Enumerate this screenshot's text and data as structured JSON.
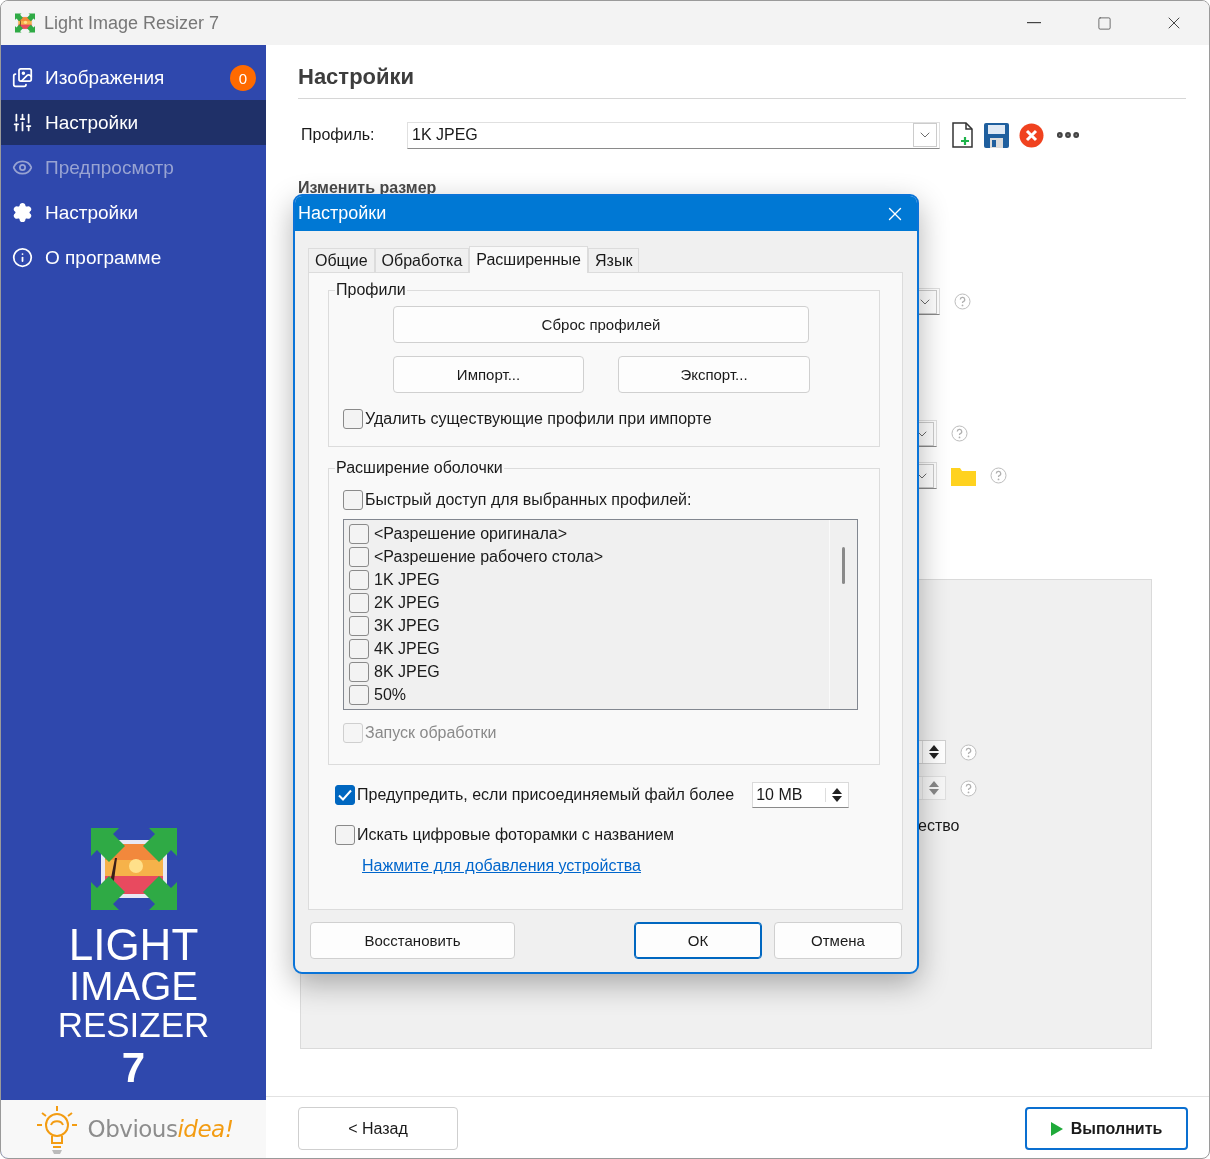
{
  "window": {
    "title": "Light Image Resizer 7"
  },
  "sidebar": {
    "items": [
      {
        "label": "Изображения",
        "badge": "0",
        "selected": false,
        "disabled": false
      },
      {
        "label": "Настройки",
        "selected": true,
        "disabled": false
      },
      {
        "label": "Предпросмотр",
        "selected": false,
        "disabled": true
      },
      {
        "label": "Настройки",
        "selected": false,
        "disabled": false
      },
      {
        "label": "О программе",
        "selected": false,
        "disabled": false
      }
    ],
    "product": [
      "LIGHT",
      "IMAGE",
      "RESIZER",
      "7"
    ],
    "brand": {
      "name": "Obvious",
      "accent": "idea!"
    }
  },
  "main": {
    "title": "Настройки",
    "profile": {
      "label": "Профиль:",
      "value": "1K JPEG"
    },
    "section_title": "Изменить размер",
    "partial_text": "ество",
    "back_button": "< Назад",
    "run_button": "Выполнить"
  },
  "dialog": {
    "title": "Настройки",
    "tabs": [
      {
        "label": "Общие",
        "selected": false
      },
      {
        "label": "Обработка",
        "selected": false
      },
      {
        "label": "Расширенные",
        "selected": true
      },
      {
        "label": "Язык",
        "selected": false
      }
    ],
    "profiles_group": {
      "title": "Профили",
      "reset": "Сброс профилей",
      "import": "Импорт...",
      "export": "Экспорт...",
      "delete_on_import": {
        "label": "Удалить существующие профили при импорте",
        "checked": false
      }
    },
    "shell_group": {
      "title": "Расширение оболочки",
      "quick_access": {
        "label": "Быстрый доступ для выбранных профилей:",
        "checked": false
      },
      "profiles": [
        {
          "label": "<Разрешение оригинала>",
          "checked": false
        },
        {
          "label": "<Разрешение рабочего стола>",
          "checked": false
        },
        {
          "label": "1K JPEG",
          "checked": false
        },
        {
          "label": "2K JPEG",
          "checked": false
        },
        {
          "label": "3K JPEG",
          "checked": false
        },
        {
          "label": "4K JPEG",
          "checked": false
        },
        {
          "label": "8K JPEG",
          "checked": false
        },
        {
          "label": "50%",
          "checked": false
        }
      ],
      "launch": {
        "label": "Запуск обработки",
        "checked": false,
        "disabled": true
      }
    },
    "warn": {
      "label": "Предупредить, если присоединяемый файл более",
      "checked": true,
      "size": "10 MB"
    },
    "frames": {
      "label": "Искать цифровые фоторамки с названием",
      "checked": false
    },
    "add_device_link": "Нажмите для добавления устройства",
    "buttons": [
      {
        "label": "Восстановить",
        "default": false
      },
      {
        "label": "ОК",
        "default": true
      },
      {
        "label": "Отмена",
        "default": false
      }
    ]
  }
}
